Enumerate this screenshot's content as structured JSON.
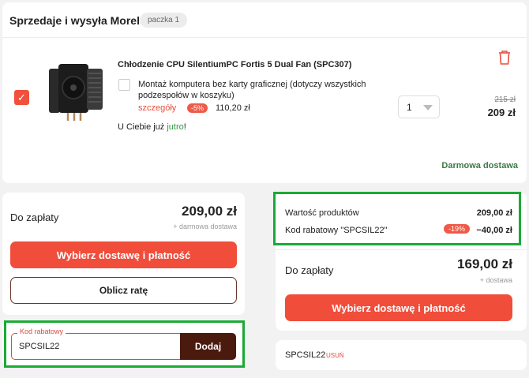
{
  "seller": {
    "title": "Sprzedaje i wysyła Morele",
    "package_badge": "paczka 1"
  },
  "product": {
    "name": "Chłodzenie CPU SilentiumPC Fortis 5 Dual Fan (SPC307)",
    "selected": true,
    "addon_text": "Montaż komputera bez karty graficznej (dotyczy wszystkich podzespołów w koszyku)",
    "addon_selected": false,
    "addon_details_link": "szczegóły",
    "addon_discount": "-5%",
    "addon_price": "110,20 zł",
    "quantity": "1",
    "old_price": "215 zł",
    "price": "209 zł",
    "availability_prefix": "U Ciebie już ",
    "availability_highlight": "jutro",
    "availability_suffix": "!",
    "free_delivery": "Darmowa dostawa"
  },
  "left_summary": {
    "label": "Do zapłaty",
    "amount": "209,00 zł",
    "sub": "+ darmowa dostawa",
    "primary_button": "Wybierz dostawę i płatność",
    "secondary_button": "Oblicz ratę"
  },
  "coupon": {
    "label": "Kod rabatowy",
    "value": "SPCSIL22",
    "button": "Dodaj"
  },
  "right_summary": {
    "products_label": "Wartość produktów",
    "products_value": "209,00 zł",
    "coupon_label": "Kod rabatowy \"SPCSIL22\"",
    "coupon_percent": "-19%",
    "coupon_value": "−40,00 zł",
    "total_label": "Do zapłaty",
    "total_amount": "169,00 zł",
    "total_sub": "+ dostawa",
    "button": "Wybierz dostawę i płatność"
  },
  "applied_coupon": {
    "code": "SPCSIL22",
    "remove": "USUŃ"
  },
  "colors": {
    "accent": "#f04d3b",
    "dark_brown": "#4a1a0e",
    "highlight_green": "#1aaa35",
    "availability_green": "#2e9b3e"
  },
  "icons": {
    "trash": "trash-icon",
    "check": "check-icon",
    "dropdown": "chevron-down-icon"
  }
}
